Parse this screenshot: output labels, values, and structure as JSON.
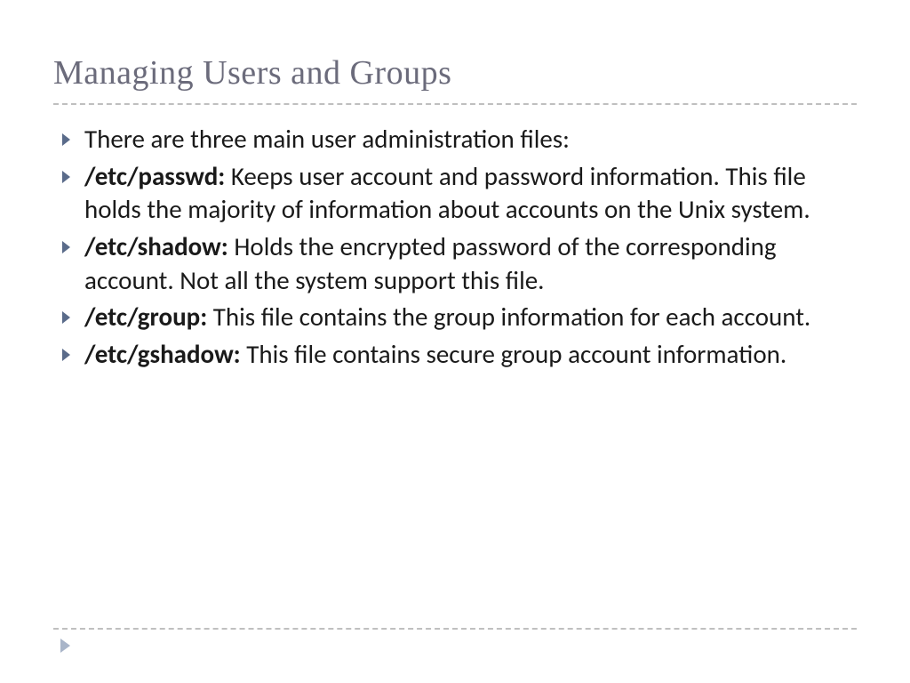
{
  "title": "Managing Users and Groups",
  "bullets": [
    {
      "label": "",
      "text": "There are three main user administration files:"
    },
    {
      "label": "/etc/passwd: ",
      "text": "Keeps user account and password information. This file holds the majority of information about accounts on the Unix system."
    },
    {
      "label": "/etc/shadow: ",
      "text": "Holds the encrypted password of the corresponding account. Not all the system support this file."
    },
    {
      "label": "/etc/group: ",
      "text": "This file contains the group information for each account."
    },
    {
      "label": "/etc/gshadow: ",
      "text": "This file contains secure group account information."
    }
  ]
}
